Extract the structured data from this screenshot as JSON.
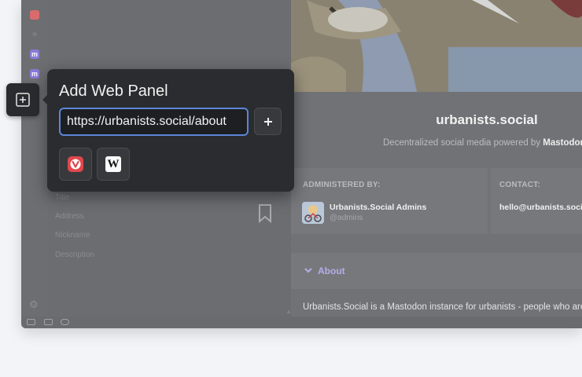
{
  "popup": {
    "title": "Add Web Panel",
    "url_value": "https://urbanists.social/about",
    "add_symbol": "+",
    "suggestions": [
      {
        "name": "Vivaldi",
        "icon": "vivaldi-icon"
      },
      {
        "name": "Wikipedia",
        "icon": "wikipedia-icon",
        "glyph": "W"
      }
    ]
  },
  "side_panel": {
    "form_labels": [
      "Title",
      "Address",
      "Nickname",
      "Description"
    ]
  },
  "page": {
    "site_name": "urbanists.social",
    "tagline_prefix": "Decentralized social media powered by ",
    "tagline_bold": "Mastodon",
    "admin_heading": "ADMINISTERED BY:",
    "contact_heading": "CONTACT:",
    "admin_name": "Urbanists.Social Admins",
    "admin_handle": "@admins",
    "contact_email": "hello@urbanists.social",
    "about_label": "About",
    "about_text": "Urbanists.Social is a Mastodon instance for urbanists - people who are"
  },
  "colors": {
    "accent_blue": "#5b86d9",
    "vivaldi_red": "#e0474c",
    "mastodon_purple": "#8a79d8",
    "about_purple": "#b3aee8"
  }
}
